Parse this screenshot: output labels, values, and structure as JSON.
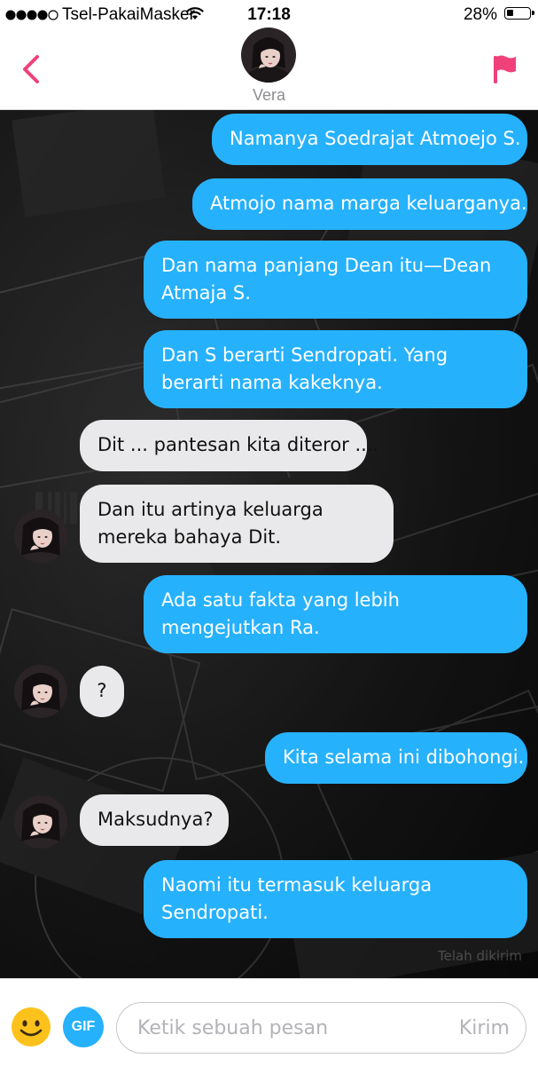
{
  "status_bar": {
    "carrier": "Tsel-PakaiMasker",
    "time": "17:18",
    "battery_percent": "28%",
    "battery_level": 0.28,
    "signal_bars_filled": 4,
    "signal_bars_total": 5
  },
  "header": {
    "contact_name": "Vera",
    "back_icon": "chevron-left-icon",
    "report_icon": "flag-icon",
    "accent_color": "#f0417a"
  },
  "messages": [
    {
      "side": "out",
      "text": "Namanya Soedrajat Atmoejo S."
    },
    {
      "side": "out",
      "text": "Atmojo nama marga keluarganya."
    },
    {
      "side": "out",
      "text": "Dan nama panjang Dean itu—Dean Atmaja S."
    },
    {
      "side": "out",
      "text": "Dan S berarti Sendropati. Yang berarti nama kakeknya."
    },
    {
      "side": "in",
      "text": "Dit ... pantesan kita diteror ...."
    },
    {
      "side": "in",
      "text": "Dan itu artinya keluarga mereka bahaya Dit."
    },
    {
      "side": "out",
      "text": "Ada satu fakta yang lebih mengejutkan Ra."
    },
    {
      "side": "in",
      "text": "?"
    },
    {
      "side": "out",
      "text": "Kita selama ini dibohongi."
    },
    {
      "side": "in",
      "text": "Maksudnya?"
    },
    {
      "side": "out",
      "text": "Naomi itu termasuk keluarga Sendropati."
    }
  ],
  "delivery_status": "Telah dikirim",
  "composer": {
    "placeholder": "Ketik sebuah pesan",
    "send_label": "Kirim",
    "gif_label": "GIF",
    "emoji_icon": "smiley-icon"
  },
  "colors": {
    "outgoing_bubble": "#26b1fc",
    "incoming_bubble": "#e9e9eb"
  }
}
